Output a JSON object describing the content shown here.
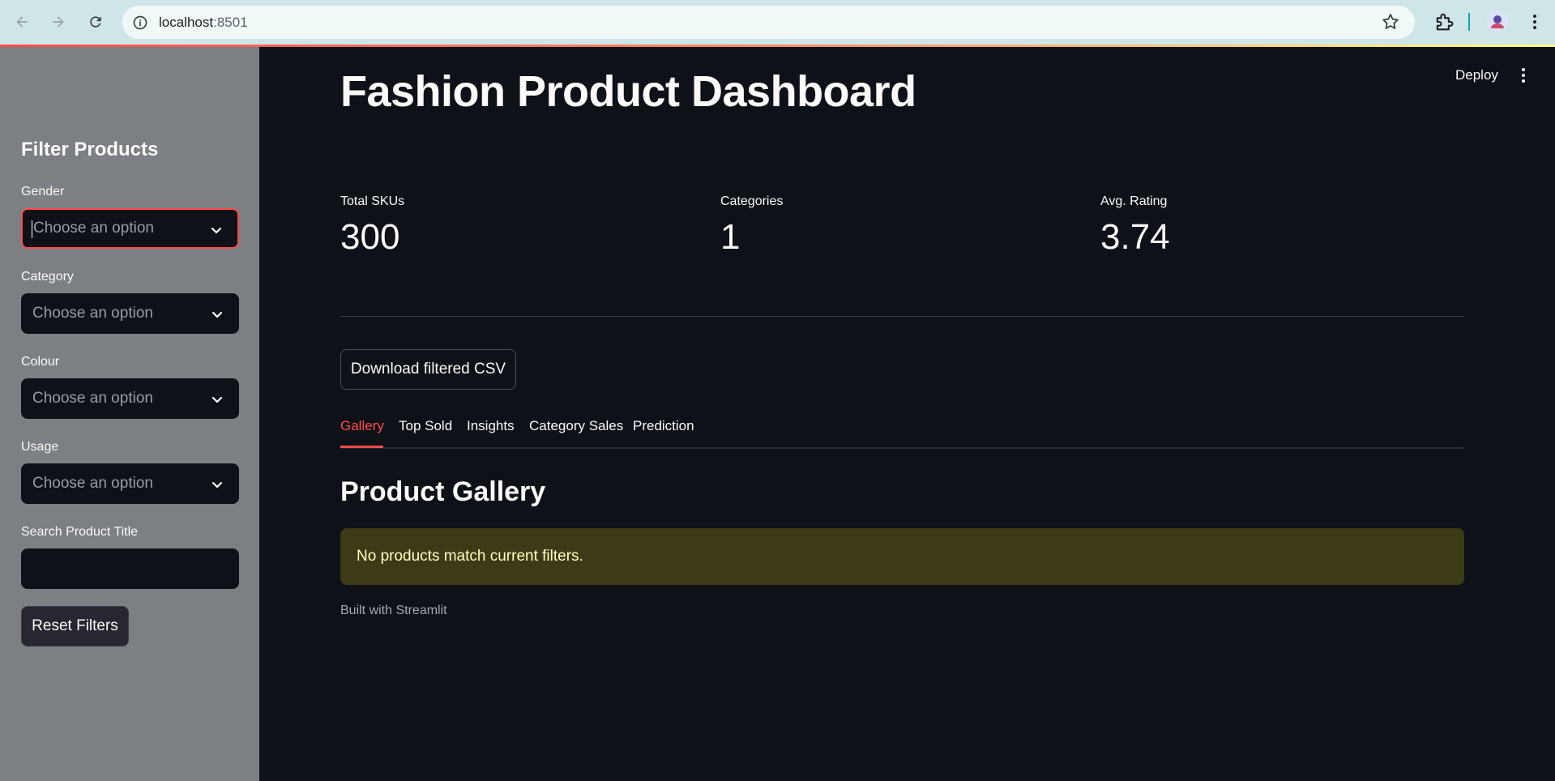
{
  "browser": {
    "url_host": "localhost",
    "url_port": ":8501"
  },
  "sidebar": {
    "title": "Filter Products",
    "filters": [
      {
        "label": "Gender",
        "placeholder": "Choose an option"
      },
      {
        "label": "Category",
        "placeholder": "Choose an option"
      },
      {
        "label": "Colour",
        "placeholder": "Choose an option"
      },
      {
        "label": "Usage",
        "placeholder": "Choose an option"
      }
    ],
    "search_label": "Search Product Title",
    "search_value": "",
    "reset_label": "Reset Filters"
  },
  "header": {
    "deploy_label": "Deploy"
  },
  "main": {
    "title": "Fashion Product Dashboard",
    "metrics": [
      {
        "label": "Total SKUs",
        "value": "300"
      },
      {
        "label": "Categories",
        "value": "1"
      },
      {
        "label": "Avg. Rating",
        "value": "3.74"
      }
    ],
    "download_label": "Download filtered CSV",
    "tabs": [
      {
        "label": "Gallery",
        "active": true
      },
      {
        "label": "Top Sold",
        "active": false
      },
      {
        "label": "Insights",
        "active": false
      },
      {
        "label": "Category Sales",
        "active": false
      },
      {
        "label": "Prediction",
        "active": false
      }
    ],
    "section_title": "Product Gallery",
    "warning": "No products match current filters.",
    "footer": "Built with Streamlit"
  },
  "colors": {
    "accent": "#ff4b4b",
    "background": "#0e1117",
    "sidebar": "#7c7f83",
    "warning_bg": "#3d3a16",
    "warning_text": "#ffffc2"
  }
}
